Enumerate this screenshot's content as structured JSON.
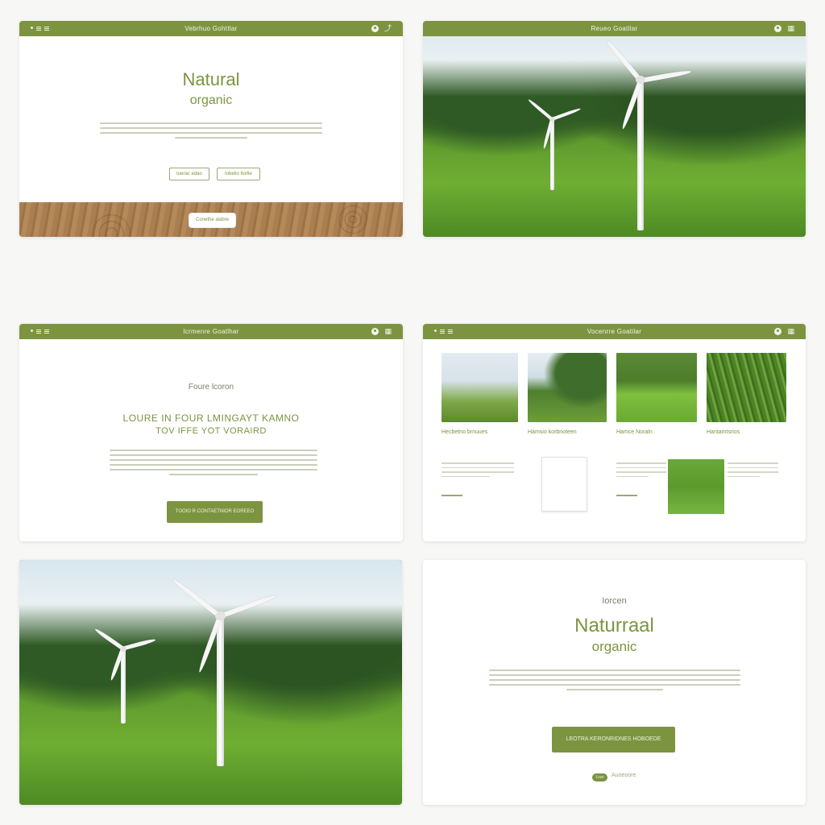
{
  "panels": {
    "p1": {
      "app_title": "Vebrhuo Gohttlar",
      "heading": "Natural",
      "subheading": "organic",
      "btn_left": "tuerac edao",
      "btn_right": "tobelio ltorlle",
      "wood_btn": "Conethe alabre"
    },
    "p2": {
      "app_title": "Reueo Goatilar"
    },
    "p3": {
      "app_title": "Icrmenre Goatlhar",
      "kicker": "Foure lcoron",
      "headline_1": "LOURE IN FOUR LMINGAYT KAMNO",
      "headline_2": "TOV IFFE YOT VORAIRD",
      "cta": "TOOIO R  CONTAETNIOR EOREEO"
    },
    "p4": {
      "app_title": "Vocenrre Goatilar",
      "captions": [
        "Hecbetno brnuues",
        "Hamsio korbnoteen",
        "Hamce Noraln",
        "Hantamtsrios"
      ]
    },
    "p6": {
      "kicker": "Iorcen",
      "heading": "Naturraal",
      "subheading": "organic",
      "cta": "LEOTRA   KERONRIDNES  HOBOEDE",
      "pill": "Lrao",
      "pill_text": "Auoeoore"
    }
  },
  "colors": {
    "accent": "#7c9440",
    "wood": "#a87c4f",
    "foliage": "#6fae33"
  }
}
